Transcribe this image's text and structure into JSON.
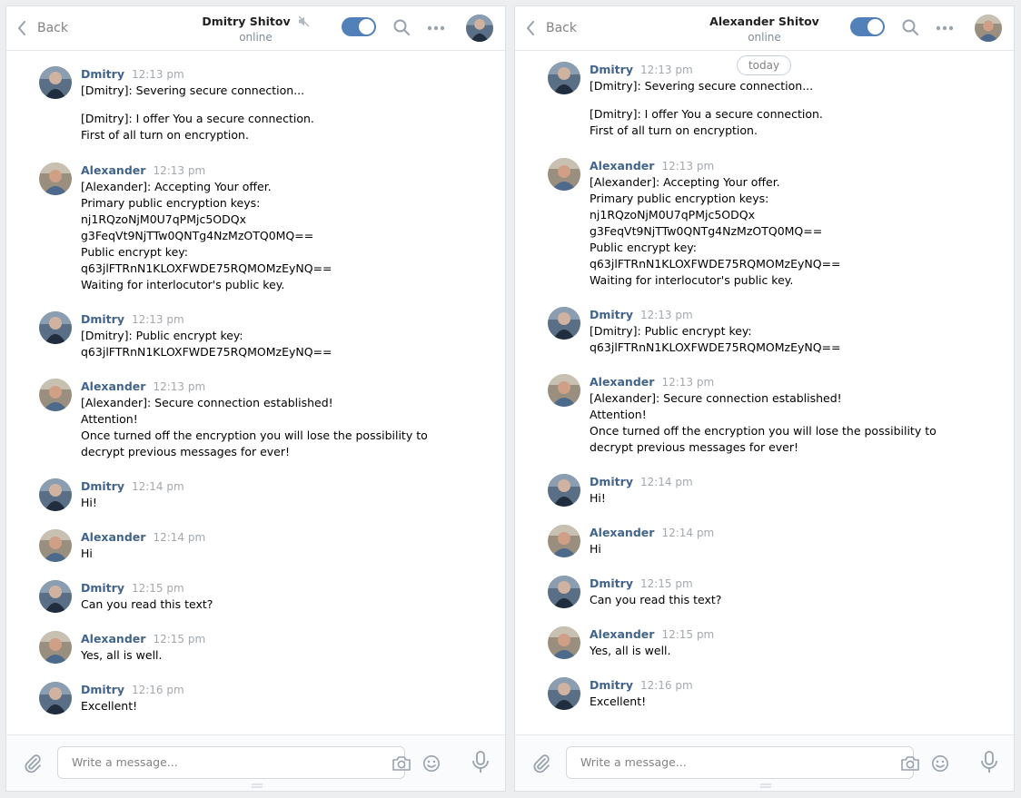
{
  "header": {
    "back_label": "Back",
    "status": "online"
  },
  "composer": {
    "placeholder": "Write a message..."
  },
  "date_pill": "today",
  "names": {
    "dmitry": "Dmitry",
    "alexander": "Alexander"
  },
  "panels": [
    {
      "peer_name": "Dmitry Shitov",
      "muted": true,
      "encryption_on": true
    },
    {
      "peer_name": "Alexander Shitov",
      "muted": false,
      "encryption_on": true
    }
  ],
  "messages": [
    {
      "author": "Dmitry",
      "time": "12:13 pm",
      "lines": [
        "[Dmitry]: Severing secure connection...",
        "[Dmitry]: I offer You a secure connection.",
        "First of all turn on encryption."
      ]
    },
    {
      "author": "Alexander",
      "time": "12:13 pm",
      "lines": [
        "[Alexander]: Accepting Your offer.",
        "Primary public encryption keys:",
        "nj1RQzoNjM0U7qPMjc5ODQx",
        "g3FeqVt9NjTTw0QNTg4NzMzOTQ0MQ==",
        "Public encrypt key:",
        "q63jlFTRnN1KLOXFWDE75RQMOMzEyNQ==",
        "Waiting for interlocutor's public key."
      ]
    },
    {
      "author": "Dmitry",
      "time": "12:13 pm",
      "lines": [
        "[Dmitry]: Public encrypt key:",
        "q63jlFTRnN1KLOXFWDE75RQMOMzEyNQ=="
      ]
    },
    {
      "author": "Alexander",
      "time": "12:13 pm",
      "lines": [
        "[Alexander]: Secure connection established!",
        "Attention!",
        "Once turned off the encryption you will lose the possibility to",
        "decrypt previous messages for ever!"
      ]
    },
    {
      "author": "Dmitry",
      "time": "12:14 pm",
      "lines": [
        "Hi!"
      ]
    },
    {
      "author": "Alexander",
      "time": "12:14 pm",
      "lines": [
        "Hi"
      ]
    },
    {
      "author": "Dmitry",
      "time": "12:15 pm",
      "lines": [
        "Can you read this text?"
      ]
    },
    {
      "author": "Alexander",
      "time": "12:15 pm",
      "lines": [
        "Yes, all is well."
      ]
    },
    {
      "author": "Dmitry",
      "time": "12:16 pm",
      "lines": [
        "Excellent!"
      ]
    }
  ],
  "colors": {
    "accent": "#5181b8",
    "author": "#42648b",
    "muted_text": "#828282",
    "time": "#a4a9ae"
  }
}
